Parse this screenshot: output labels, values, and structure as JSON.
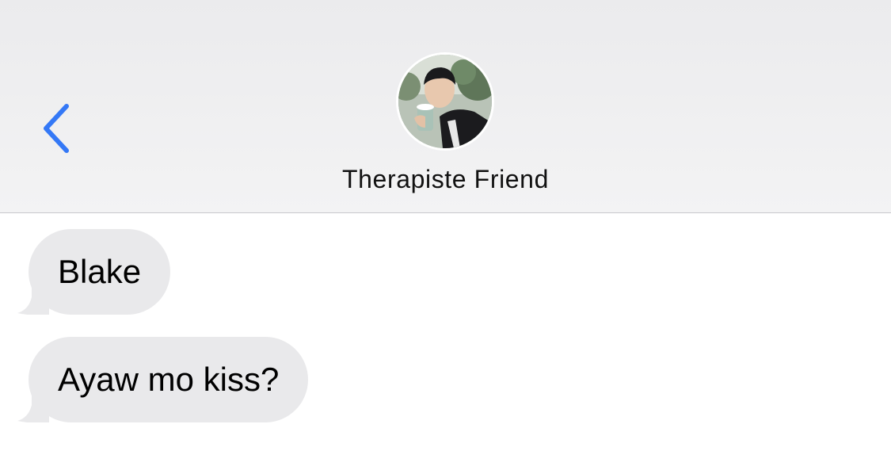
{
  "header": {
    "contact_name": "Therapiste Friend",
    "back_icon": "chevron-left-icon",
    "avatar": "contact-photo"
  },
  "colors": {
    "accent": "#3478f6",
    "incoming_bubble": "#e9e9eb",
    "header_bg": "#f0f0f1"
  },
  "messages": [
    {
      "direction": "incoming",
      "text": "Blake"
    },
    {
      "direction": "incoming",
      "text": "Ayaw mo kiss?"
    }
  ]
}
